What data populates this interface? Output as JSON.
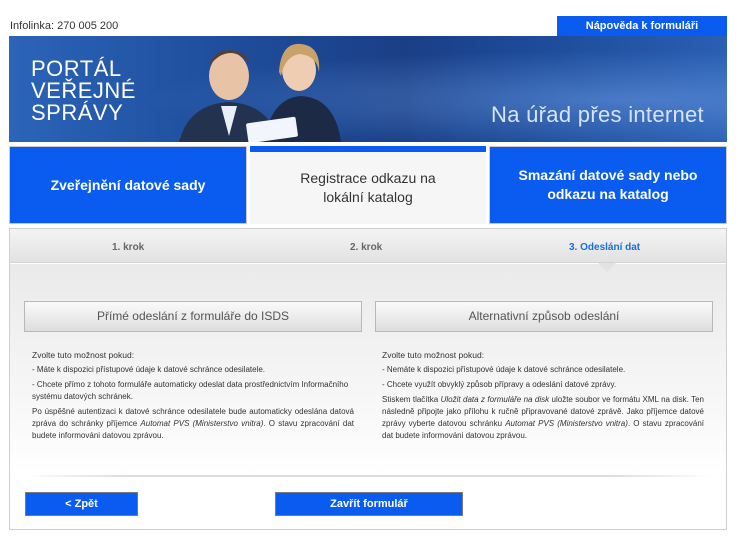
{
  "header": {
    "infolink": "Infolinka: 270 005 200",
    "help_label": "Nápověda k formuláři"
  },
  "banner": {
    "title_lines": [
      "PORTÁL",
      "VEŘEJNÉ",
      "SPRÁVY"
    ],
    "slogan": "Na úřad přes internet"
  },
  "tabs": [
    {
      "label": "Zveřejnění datové sady"
    },
    {
      "label_line1": "Registrace odkazu na",
      "label_line2": "lokální katalog"
    },
    {
      "label_line1": "Smazání datové sady nebo",
      "label_line2": "odkazu na katalog"
    }
  ],
  "steps": [
    {
      "label": "1. krok"
    },
    {
      "label": "2. krok"
    },
    {
      "label": "3. Odeslání dat"
    }
  ],
  "options": {
    "left": {
      "button": "Přímé odeslání z formuláře do ISDS",
      "intro": "Zvolte tuto možnost pokud:",
      "bullet1": "- Máte k dispozici přístupové údaje k datové schránce odesilatele.",
      "bullet2": "- Chcete přímo z tohoto formuláře automaticky odeslat data prostřednictvím Informačního systému datových schránek.",
      "para_a": "Po úspěšné autentizaci k datové schránce odesilatele bude automaticky odeslána datová zpráva do schránky příjemce ",
      "para_em": "Automat PVS (Ministerstvo vnitra)",
      "para_b": ". O stavu zpracování dat budete informováni datovou zprávou."
    },
    "right": {
      "button": "Alternativní způsob odeslání",
      "intro": "Zvolte tuto možnost pokud:",
      "bullet1": "- Nemáte k dispozici přístupové údaje k datové schránce odesilatele.",
      "bullet2": "- Chcete využít obvyklý způsob přípravy a odeslání datové zprávy.",
      "para_a": "Stiskem tlačítka ",
      "para_em1": "Uložit data z formuláře na disk",
      "para_b": " uložte soubor ve formátu XML na disk. Ten následně připojte jako přílohu k ručně připravované datové zprávě. Jako příjemce datové zprávy vyberte datovou schránku ",
      "para_em2": "Automat PVS (Ministerstvo vnitra)",
      "para_c": ". O stavu zpracování dat budete informováni datovou zprávou."
    }
  },
  "actions": {
    "back": "< Zpět",
    "close": "Zavřít formulář"
  },
  "colors": {
    "accent": "#0a5cf0",
    "banner_dark": "#1a3f86",
    "active_step": "#1a6fd8"
  }
}
